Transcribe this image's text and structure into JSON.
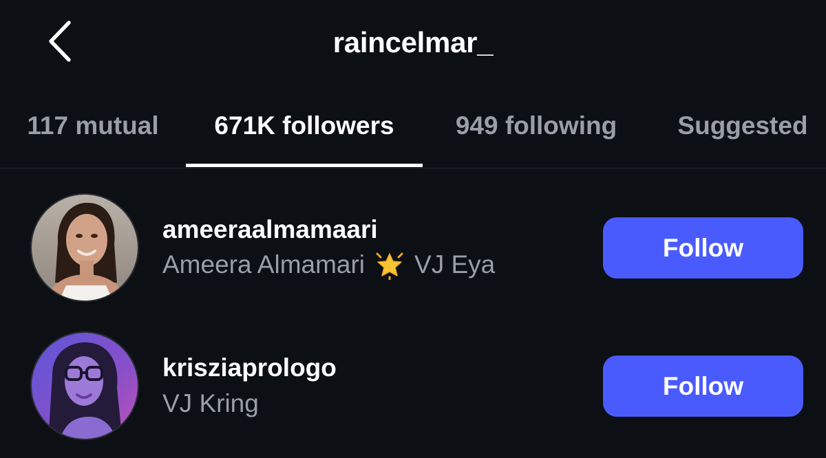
{
  "header": {
    "title": "raincelmar_",
    "back_icon": "chevron-left-icon"
  },
  "tabs": [
    {
      "label": "117 mutual",
      "active": false
    },
    {
      "label": "671K followers",
      "active": true
    },
    {
      "label": "949 following",
      "active": false
    },
    {
      "label": "Suggested",
      "active": false
    }
  ],
  "users": [
    {
      "username": "ameeraalmamaari",
      "display_name": "Ameera Almamari",
      "badge_icon": "glowing-star-icon",
      "extra": "VJ Eya",
      "follow_label": "Follow"
    },
    {
      "username": "krisziaprologo",
      "display_name": "VJ Kring",
      "follow_label": "Follow"
    }
  ],
  "colors": {
    "background": "#0c0f14",
    "accent": "#4a5bfd",
    "muted_text": "#9a9ea6",
    "primary_text": "#ffffff"
  }
}
